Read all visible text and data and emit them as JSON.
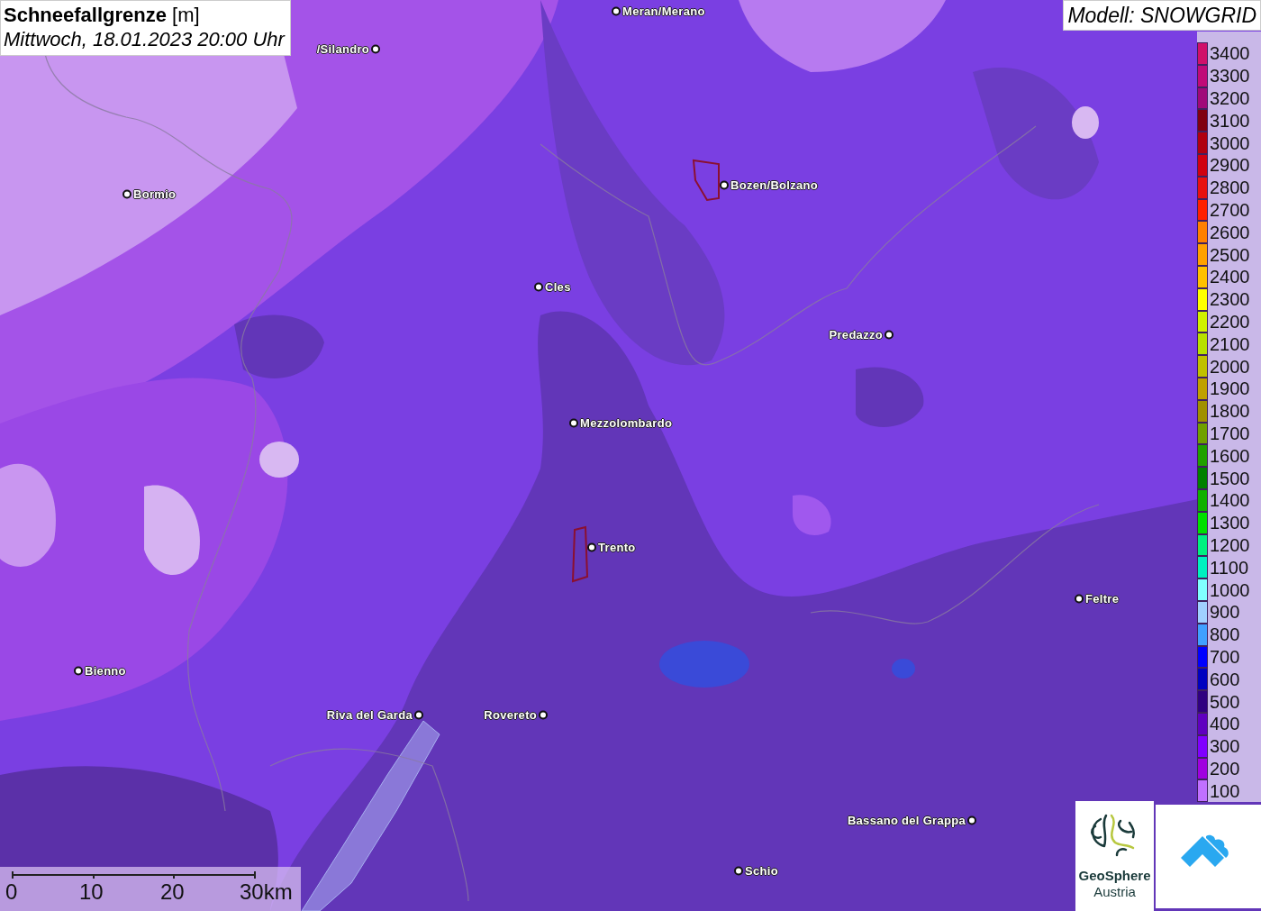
{
  "title": {
    "heading": "Schneefallgrenze",
    "unit": "[m]",
    "datetime": "Mittwoch, 18.01.2023 20:00 Uhr"
  },
  "model": "Modell: SNOWGRID",
  "cities": [
    {
      "name": "Meran/Merano"
    },
    {
      "name": "/Silandro"
    },
    {
      "name": "Bormio"
    },
    {
      "name": "Bozen/Bolzano"
    },
    {
      "name": "Cles"
    },
    {
      "name": "Predazzo"
    },
    {
      "name": "Mezzolombardo"
    },
    {
      "name": "Trento"
    },
    {
      "name": "Feltre"
    },
    {
      "name": "Bienno"
    },
    {
      "name": "Riva del Garda"
    },
    {
      "name": "Rovereto"
    },
    {
      "name": "Bassano del Grappa"
    },
    {
      "name": "Schio"
    }
  ],
  "legend": [
    {
      "label": "3400",
      "color": "#d0106a"
    },
    {
      "label": "3300",
      "color": "#c00a78"
    },
    {
      "label": "3200",
      "color": "#a0087a"
    },
    {
      "label": "3100",
      "color": "#800010"
    },
    {
      "label": "3000",
      "color": "#b00010"
    },
    {
      "label": "2900",
      "color": "#d00010"
    },
    {
      "label": "2800",
      "color": "#e81010"
    },
    {
      "label": "2700",
      "color": "#ff2000"
    },
    {
      "label": "2600",
      "color": "#ff8000"
    },
    {
      "label": "2500",
      "color": "#ffa000"
    },
    {
      "label": "2400",
      "color": "#ffc000"
    },
    {
      "label": "2300",
      "color": "#ffff00"
    },
    {
      "label": "2200",
      "color": "#d0f000"
    },
    {
      "label": "2100",
      "color": "#b8e000"
    },
    {
      "label": "2000",
      "color": "#c0c000"
    },
    {
      "label": "1900",
      "color": "#c0a000"
    },
    {
      "label": "1800",
      "color": "#a09000"
    },
    {
      "label": "1700",
      "color": "#70a000"
    },
    {
      "label": "1600",
      "color": "#20a000"
    },
    {
      "label": "1500",
      "color": "#008000"
    },
    {
      "label": "1400",
      "color": "#10b000"
    },
    {
      "label": "1300",
      "color": "#00e000"
    },
    {
      "label": "1200",
      "color": "#00f080"
    },
    {
      "label": "1100",
      "color": "#00f0c0"
    },
    {
      "label": "1000",
      "color": "#80ffff"
    },
    {
      "label": "900",
      "color": "#a0d0ff"
    },
    {
      "label": "800",
      "color": "#40a0ff"
    },
    {
      "label": "700",
      "color": "#0000ff"
    },
    {
      "label": "600",
      "color": "#0000c0"
    },
    {
      "label": "500",
      "color": "#300080"
    },
    {
      "label": "400",
      "color": "#6000c0"
    },
    {
      "label": "300",
      "color": "#8000ff"
    },
    {
      "label": "200",
      "color": "#a000e0"
    },
    {
      "label": "100",
      "color": "#c070ff"
    }
  ],
  "scale": [
    "0",
    "10",
    "20",
    "30km"
  ],
  "logos": {
    "org_line1": "GeoSphere",
    "org_line2": "Austria"
  }
}
